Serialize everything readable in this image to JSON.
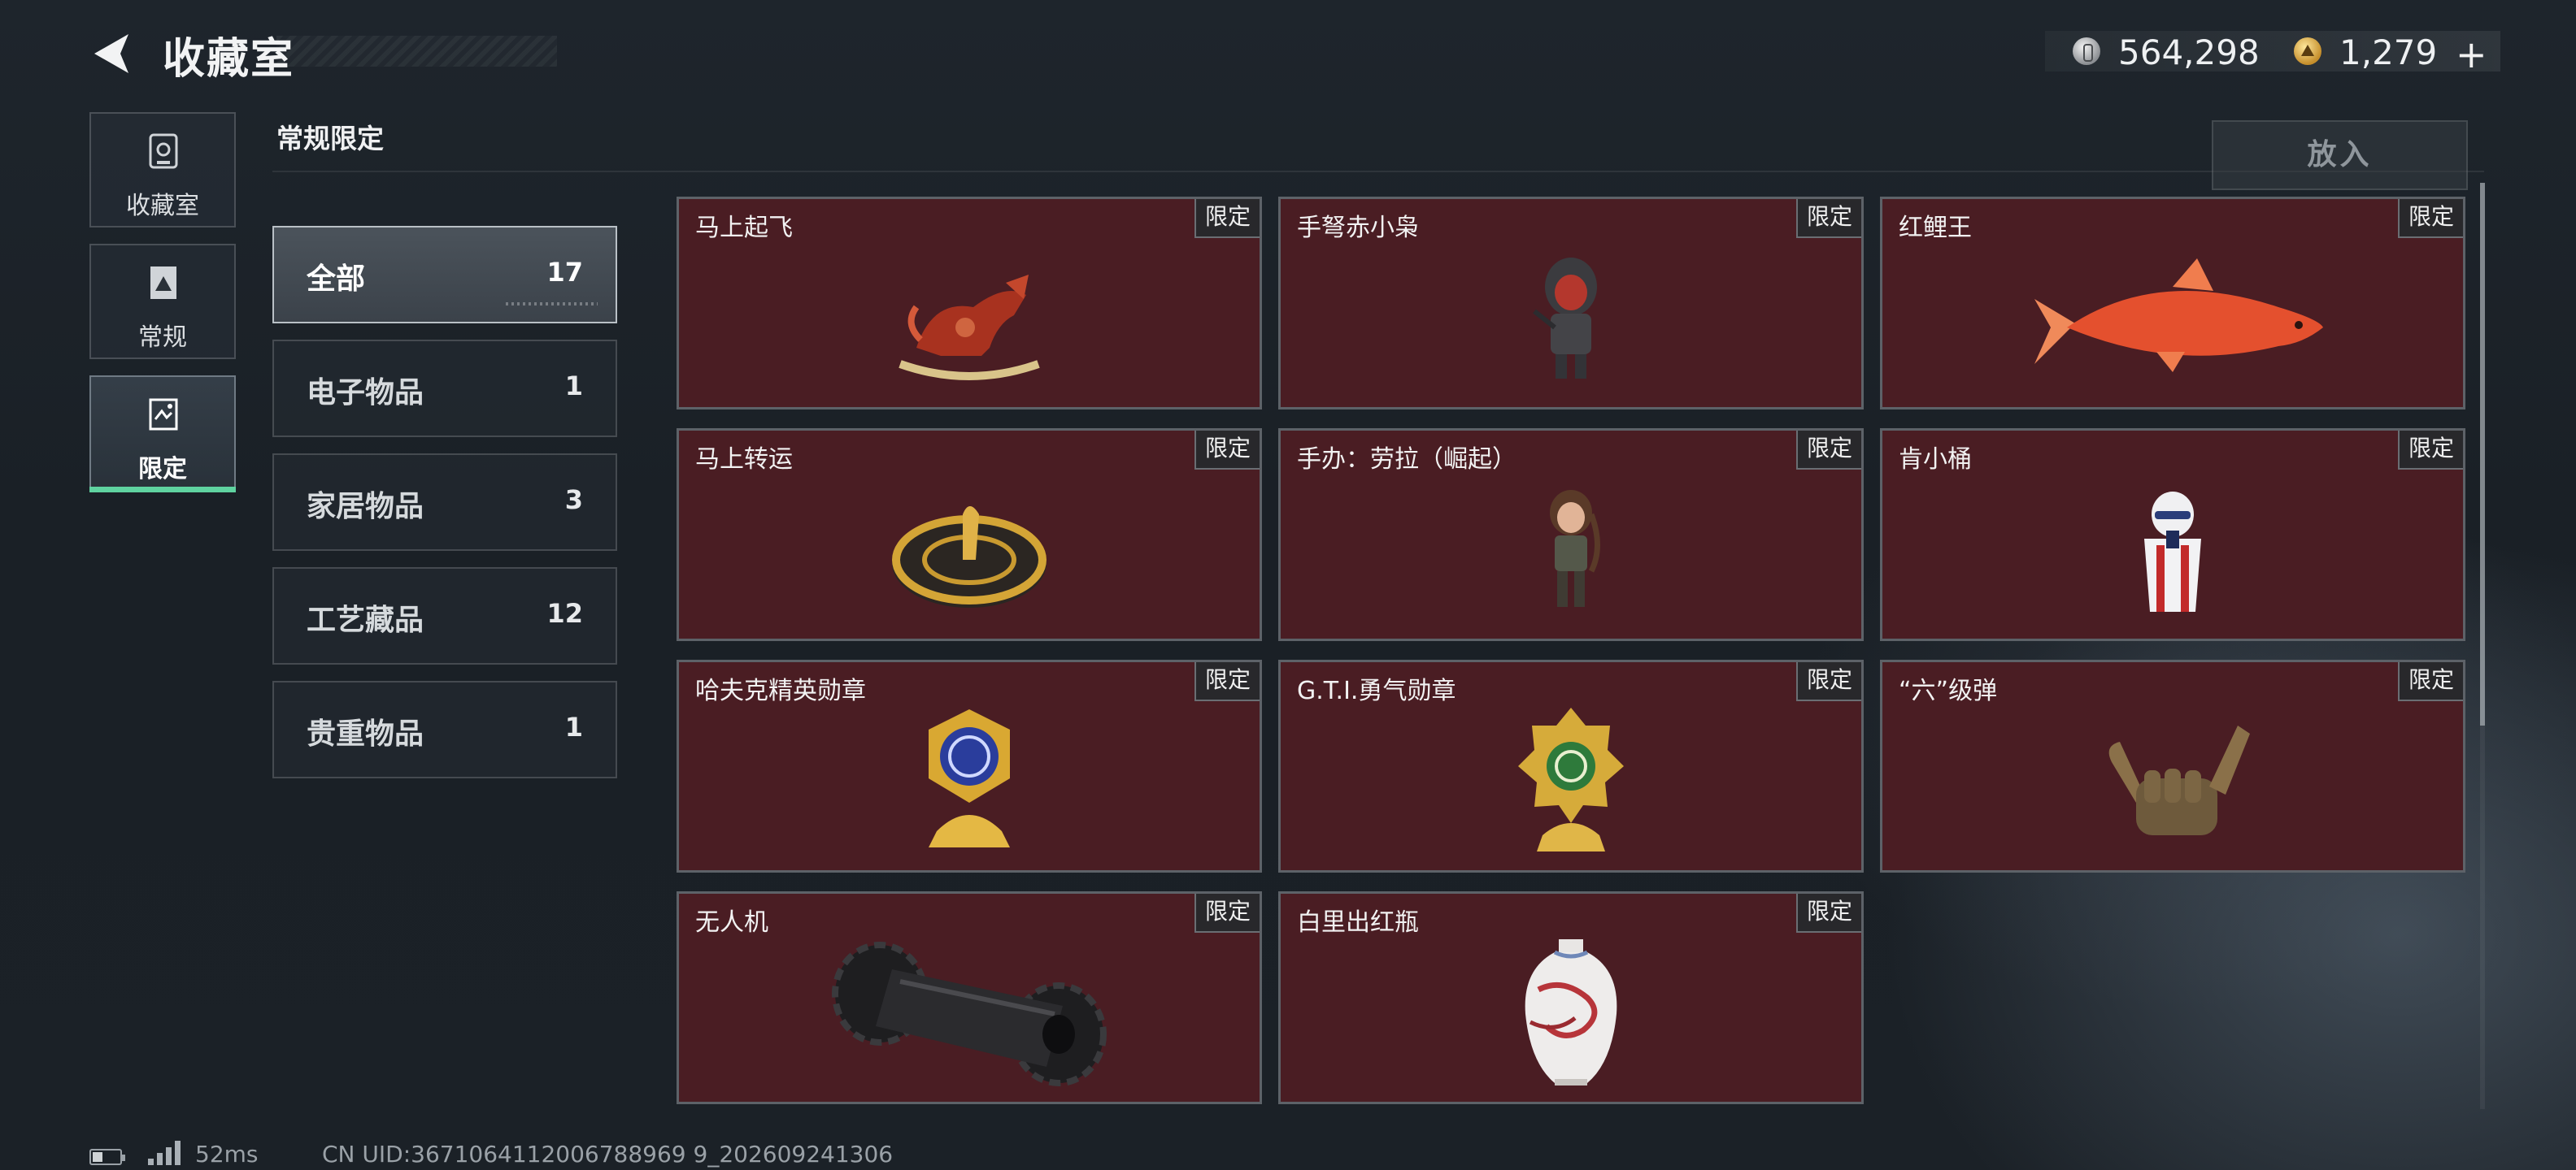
{
  "header": {
    "title": "收藏室",
    "currency": {
      "silver": "564,298",
      "gold": "1,279"
    }
  },
  "sidebar": {
    "items": [
      {
        "label": "收藏室",
        "icon": "collection-icon"
      },
      {
        "label": "常规",
        "icon": "regular-icon"
      },
      {
        "label": "限定",
        "icon": "limited-icon",
        "selected": true
      }
    ]
  },
  "section": {
    "title": "常规限定",
    "put_in_label": "放入",
    "put_in_enabled": false
  },
  "categories": [
    {
      "name": "全部",
      "count": "17",
      "active": true
    },
    {
      "name": "电子物品",
      "count": "1"
    },
    {
      "name": "家居物品",
      "count": "3"
    },
    {
      "name": "工艺藏品",
      "count": "12"
    },
    {
      "name": "贵重物品",
      "count": "1"
    }
  ],
  "tag_label": "限定",
  "items": [
    {
      "name": "马上起飞",
      "art": "rocking-horse"
    },
    {
      "name": "手弩赤小枭",
      "art": "hooded-figure"
    },
    {
      "name": "红鲤王",
      "art": "koi-fish"
    },
    {
      "name": "马上转运",
      "art": "compass-disc"
    },
    {
      "name": "手办：劳拉（崛起）",
      "art": "adventurer-figure"
    },
    {
      "name": "肯小桶",
      "art": "colonel-bucket"
    },
    {
      "name": "哈夫克精英勋章",
      "art": "blue-medal"
    },
    {
      "name": "G.T.I.勇气勋章",
      "art": "green-medal"
    },
    {
      "name": "“六”级弹",
      "art": "hand-gesture"
    },
    {
      "name": "无人机",
      "art": "drone-roller"
    },
    {
      "name": "白里出红瓶",
      "art": "porcelain-vase"
    }
  ],
  "footer": {
    "ping": "52ms",
    "uid": "CN UID:3671064112006788969 9_202609241306"
  },
  "colors": {
    "card_bg": "#4a1d23",
    "accent_green": "#5fd3a0",
    "background": "#1b2127"
  }
}
